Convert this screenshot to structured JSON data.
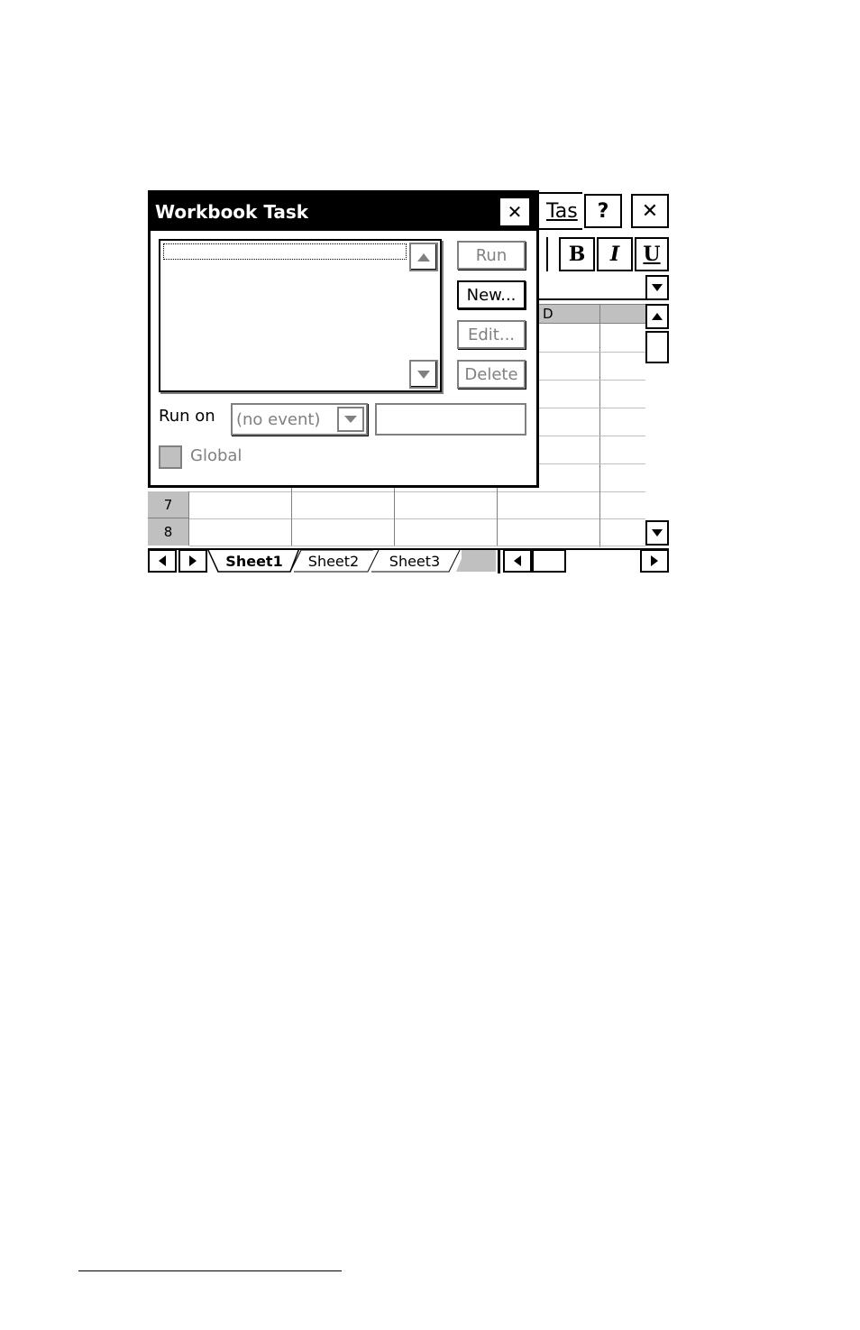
{
  "dialog": {
    "title": "Workbook Task",
    "close_glyph": "✕",
    "buttons": {
      "run": "Run",
      "new": "New...",
      "edit": "Edit...",
      "delete": "Delete"
    },
    "run_on_label": "Run on",
    "run_on_value": "(no event)",
    "run_on_text": "",
    "global_label": "Global"
  },
  "background": {
    "title_fragment": "Tas",
    "help_glyph": "?",
    "close_glyph": "✕",
    "format_buttons": {
      "bold": "B",
      "italic": "I",
      "underline": "U"
    },
    "column_header": "D",
    "row_numbers": [
      "7",
      "8"
    ],
    "sheet_tabs": [
      "Sheet1",
      "Sheet2",
      "Sheet3"
    ],
    "active_tab": "Sheet1"
  },
  "icons": {
    "scroll_up": "arrow-up-icon",
    "scroll_down": "arrow-down-icon",
    "scroll_left": "arrow-left-icon",
    "scroll_right": "arrow-right-icon"
  }
}
